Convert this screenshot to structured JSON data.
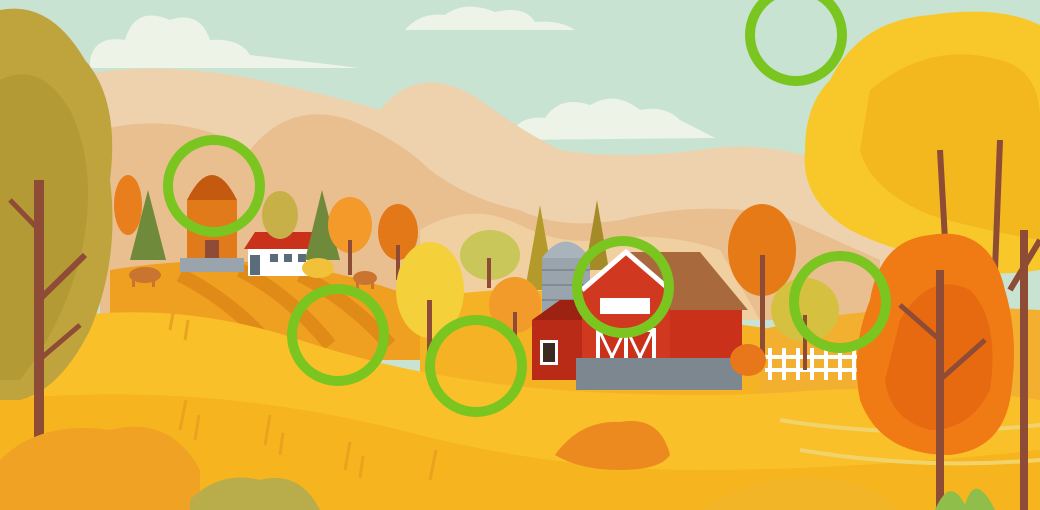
{
  "scene": {
    "name": "autumn-farm-landscape",
    "palette": {
      "sky": "#c9e3d3",
      "mountain_far": "#eed2ae",
      "mountain_mid": "#e9bf8f",
      "hill_orange": "#f0a020",
      "field_yellow": "#f9c02a",
      "barn_red": "#c9311b",
      "barn_roof": "#a86a3c",
      "silo_gray": "#9aa4ad",
      "trunk_brown": "#8e4b36",
      "fence_white": "#ffffff",
      "marker_green": "#7ac520"
    }
  },
  "markers": {
    "color": "#7ac520",
    "items": [
      {
        "id": "top-right-sky"
      },
      {
        "id": "tower-top"
      },
      {
        "id": "striped-field"
      },
      {
        "id": "yellow-tree-base"
      },
      {
        "id": "barn-roof-front"
      },
      {
        "id": "orange-tree-right"
      }
    ]
  }
}
